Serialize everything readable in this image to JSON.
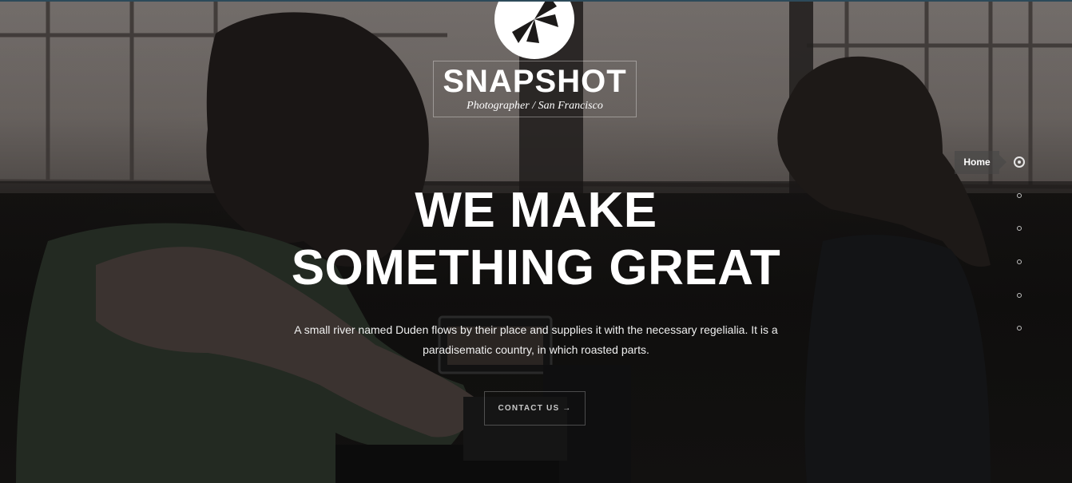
{
  "logo": {
    "icon": "camera-aperture-icon",
    "title": "SNAPSHOT",
    "subtitle": "Photographer / San Francisco"
  },
  "hero": {
    "headline_line1": "WE MAKE",
    "headline_line2": "SOMETHING GREAT",
    "lead": "A small river named Duden flows by their place and supplies it with the necessary regelialia. It is a paradisematic country, in which roasted parts.",
    "cta_label": "CONTACT US →"
  },
  "dot_nav": {
    "active_label": "Home",
    "active_index": 0,
    "count": 6
  },
  "colors": {
    "text": "#ffffff",
    "top_border": "#2d4a5a"
  }
}
